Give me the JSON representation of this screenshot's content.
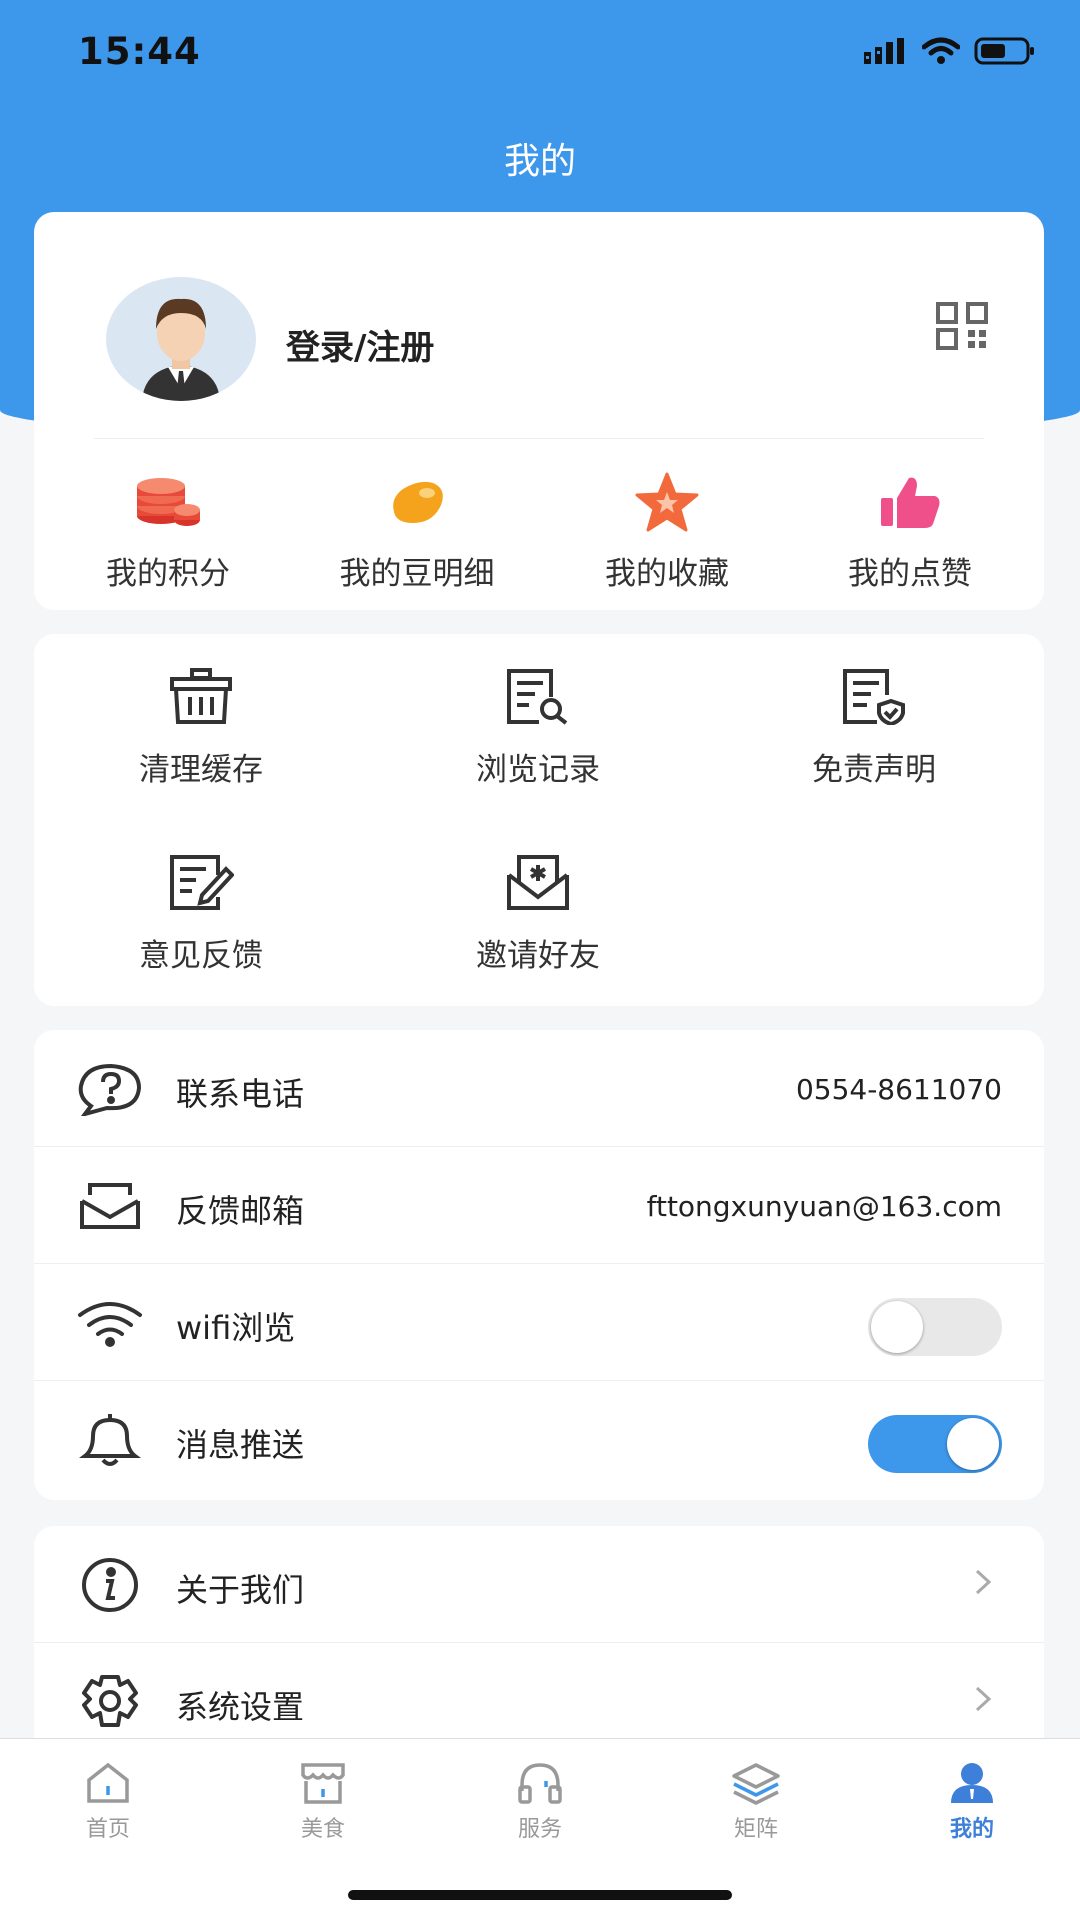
{
  "status": {
    "time": "15:44"
  },
  "header": {
    "title": "我的"
  },
  "profile": {
    "login_label": "登录/注册"
  },
  "stats": [
    {
      "label": "我的积分",
      "icon": "coins-icon"
    },
    {
      "label": "我的豆明细",
      "icon": "bean-icon"
    },
    {
      "label": "我的收藏",
      "icon": "star-icon"
    },
    {
      "label": "我的点赞",
      "icon": "thumbs-up-icon"
    }
  ],
  "tools": [
    {
      "label": "清理缓存",
      "icon": "trash-icon"
    },
    {
      "label": "浏览记录",
      "icon": "history-icon"
    },
    {
      "label": "免责声明",
      "icon": "disclaimer-icon"
    },
    {
      "label": "意见反馈",
      "icon": "feedback-icon"
    },
    {
      "label": "邀请好友",
      "icon": "invite-icon"
    }
  ],
  "settings": {
    "phone": {
      "label": "联系电话",
      "value": "0554-8611070",
      "icon": "question-chat-icon"
    },
    "email": {
      "label": "反馈邮箱",
      "value": "fttongxunyuan@163.com",
      "icon": "mail-icon"
    },
    "wifi": {
      "label": "wifi浏览",
      "enabled": false,
      "icon": "wifi-icon"
    },
    "push": {
      "label": "消息推送",
      "enabled": true,
      "icon": "bell-icon"
    },
    "about": {
      "label": "关于我们",
      "icon": "info-icon"
    },
    "system": {
      "label": "系统设置",
      "icon": "gear-icon"
    }
  },
  "tabbar": [
    {
      "label": "首页",
      "icon": "home-icon",
      "active": false
    },
    {
      "label": "美食",
      "icon": "store-icon",
      "active": false
    },
    {
      "label": "服务",
      "icon": "headphones-icon",
      "active": false
    },
    {
      "label": "矩阵",
      "icon": "layers-icon",
      "active": false
    },
    {
      "label": "我的",
      "icon": "user-icon",
      "active": true
    }
  ],
  "colors": {
    "brand": "#3d97ea",
    "active_tab": "#3d7fd9"
  }
}
